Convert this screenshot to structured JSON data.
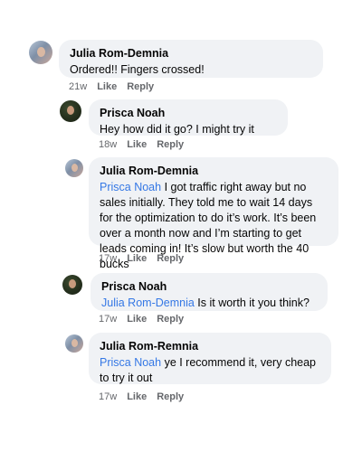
{
  "comments": [
    {
      "author": "Julia Rom-Demnia",
      "mention": "",
      "text": "Ordered!! Fingers crossed!",
      "time": "21w",
      "like": "Like",
      "reply": "Reply"
    },
    {
      "author": "Prisca Noah",
      "mention": "",
      "text": "Hey how did it go? I might try it",
      "time": "18w",
      "like": "Like",
      "reply": "Reply"
    },
    {
      "author": "Julia Rom-Demnia",
      "mention": "Prisca Noah",
      "text": " I got traffic right away but no sales initially. They told me to wait 14 days for the optimization to do it’s work. It’s been over a month now and I’m starting to get leads coming in! It’s slow but worth the 40 bucks",
      "time": "17w",
      "like": "Like",
      "reply": "Reply"
    },
    {
      "author": "Prisca Noah",
      "mention": "Julia Rom-Demnia",
      "text": " Is it worth it you think?",
      "time": "17w",
      "like": "Like",
      "reply": "Reply"
    },
    {
      "author": "Julia Rom-Remnia",
      "mention": "Prisca Noah",
      "text": " ye I recommend it, very cheap to try it out",
      "time": "17w",
      "like": "Like",
      "reply": "Reply"
    }
  ],
  "colors": {
    "bubble": "#f0f2f5",
    "mention": "#3578e5",
    "meta": "#65676b"
  }
}
